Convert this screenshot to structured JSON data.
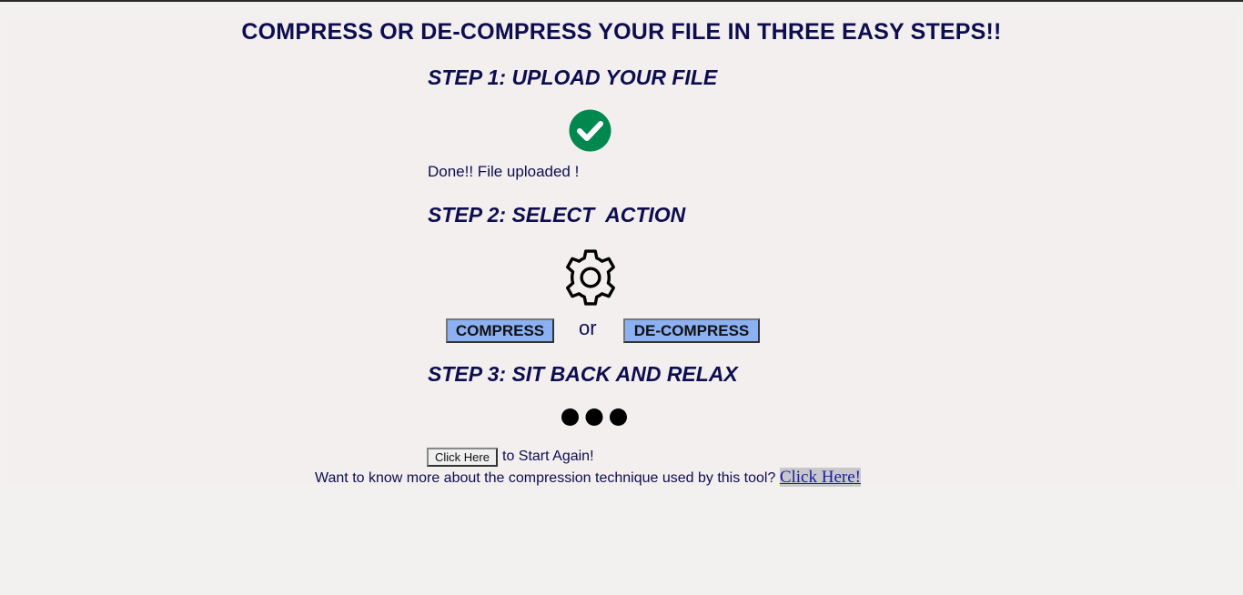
{
  "header": {
    "title": "COMPRESS OR DE-COMPRESS YOUR FILE IN THREE EASY STEPS!!"
  },
  "step1": {
    "heading": "STEP 1: UPLOAD YOUR FILE",
    "status": "Done!! File uploaded !",
    "icon": "check-circle-icon",
    "icon_color": "#00884f"
  },
  "step2": {
    "heading": "STEP 2: SELECT  ACTION",
    "icon": "gear-icon",
    "compress_label": "COMPRESS",
    "or_label": "or",
    "decompress_label": "DE-COMPRESS",
    "button_color": "#8cb1f3"
  },
  "step3": {
    "heading": "STEP 3: SIT BACK AND RELAX",
    "icon": "loading-dots-icon"
  },
  "footer": {
    "restart_button": "Click Here",
    "restart_text": "to Start Again!",
    "info_text": "Want to know more about the compression technique used by this tool?",
    "info_link": "Click Here!"
  },
  "colors": {
    "text": "#0d0d4f",
    "background": "#f3f1f0"
  }
}
